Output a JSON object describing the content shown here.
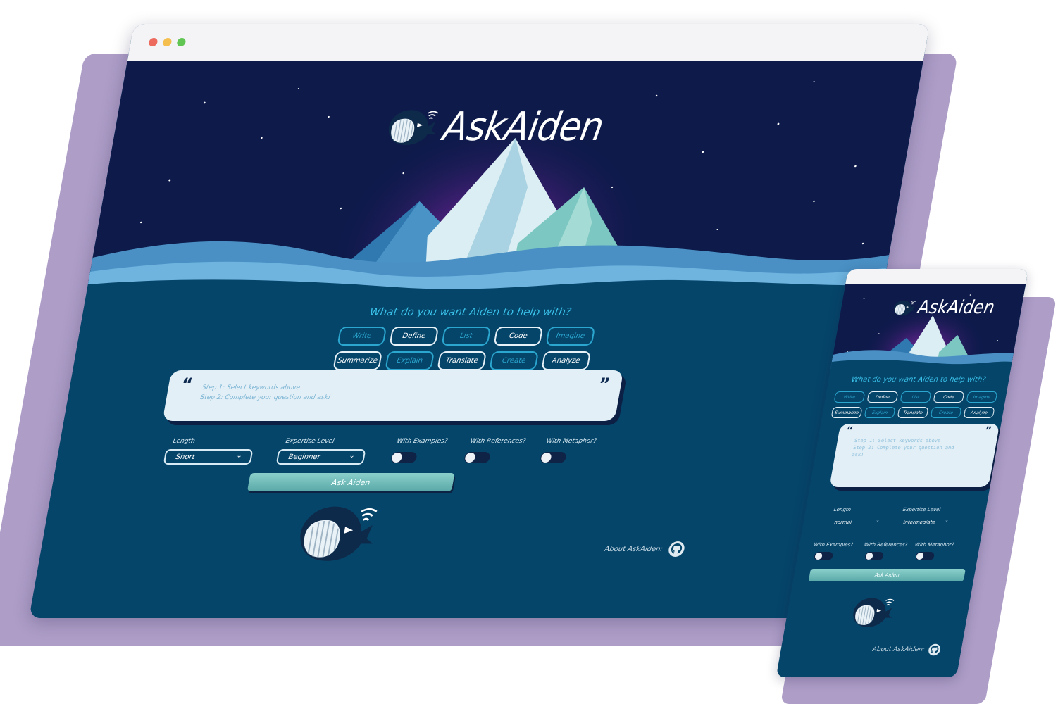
{
  "app": {
    "name": "AskAiden"
  },
  "colors": {
    "accent": "#2aa6cf",
    "heading": "#39c0e8",
    "ocean": "#06456a",
    "sky": "#0d1a4a",
    "button": "#6fbdbb",
    "shadow": "#ad9dc7"
  },
  "window_controls": [
    "close",
    "minimize",
    "maximize"
  ],
  "desktop": {
    "heading": "What do you want Aiden to help with?",
    "keywords_row1": [
      {
        "label": "Write",
        "selected": false
      },
      {
        "label": "Define",
        "selected": true
      },
      {
        "label": "List",
        "selected": false
      },
      {
        "label": "Code",
        "selected": true
      },
      {
        "label": "Imagine",
        "selected": false
      }
    ],
    "keywords_row2": [
      {
        "label": "Summarize",
        "selected": true
      },
      {
        "label": "Explain",
        "selected": false
      },
      {
        "label": "Translate",
        "selected": true
      },
      {
        "label": "Create",
        "selected": false
      },
      {
        "label": "Analyze",
        "selected": true
      }
    ],
    "prompt": {
      "step1": "Step 1: Select keywords above",
      "step2": "Step 2: Complete your question and ask!"
    },
    "length": {
      "label": "Length",
      "value": "Short"
    },
    "expertise": {
      "label": "Expertise Level",
      "value": "Beginner"
    },
    "toggles": [
      {
        "label": "With Examples?",
        "on": false
      },
      {
        "label": "With References?",
        "on": false
      },
      {
        "label": "With Metaphor?",
        "on": false
      }
    ],
    "ask_button": "Ask Aiden",
    "about": "About AskAiden:"
  },
  "mobile": {
    "heading": "What do you want Aiden to help with?",
    "keywords_row1": [
      {
        "label": "Write",
        "selected": false
      },
      {
        "label": "Define",
        "selected": true
      },
      {
        "label": "List",
        "selected": false
      },
      {
        "label": "Code",
        "selected": true
      },
      {
        "label": "Imagine",
        "selected": false
      }
    ],
    "keywords_row2": [
      {
        "label": "Summarize",
        "selected": true
      },
      {
        "label": "Explain",
        "selected": false
      },
      {
        "label": "Translate",
        "selected": true
      },
      {
        "label": "Create",
        "selected": false
      },
      {
        "label": "Analyze",
        "selected": true
      }
    ],
    "prompt": {
      "step1": "Step 1: Select keywords above",
      "step2a": "Step 2: Complete your question and",
      "step2b": "ask!"
    },
    "length": {
      "label": "Length",
      "value": "normal"
    },
    "expertise": {
      "label": "Expertise Level",
      "value": "intermediate"
    },
    "toggles": [
      {
        "label": "With Examples?",
        "on": false
      },
      {
        "label": "With References?",
        "on": false
      },
      {
        "label": "With Metaphor?",
        "on": false
      }
    ],
    "ask_button": "Ask Aiden",
    "about": "About AskAiden:"
  }
}
